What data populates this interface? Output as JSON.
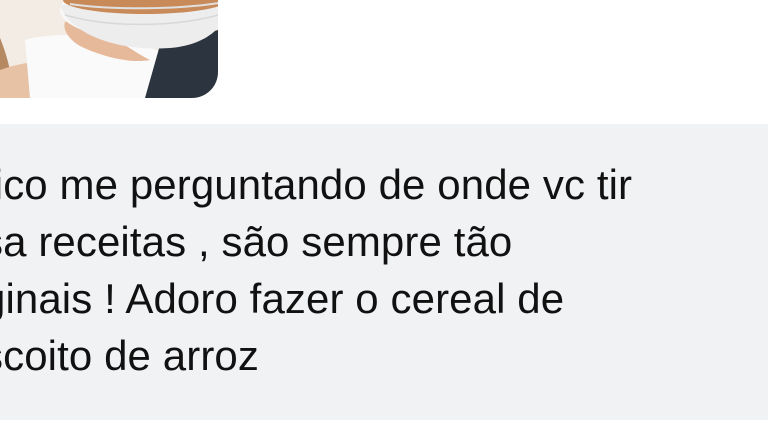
{
  "comment": {
    "lines": [
      " fico me perguntando de onde vc tir",
      "sa receitas , são sempre tão",
      "ginais ! Adoro fazer o cereal de",
      "scoito de arroz"
    ]
  },
  "colors": {
    "bubble_background": "#f1f2f4",
    "text": "#111111",
    "page_background": "#ffffff"
  }
}
